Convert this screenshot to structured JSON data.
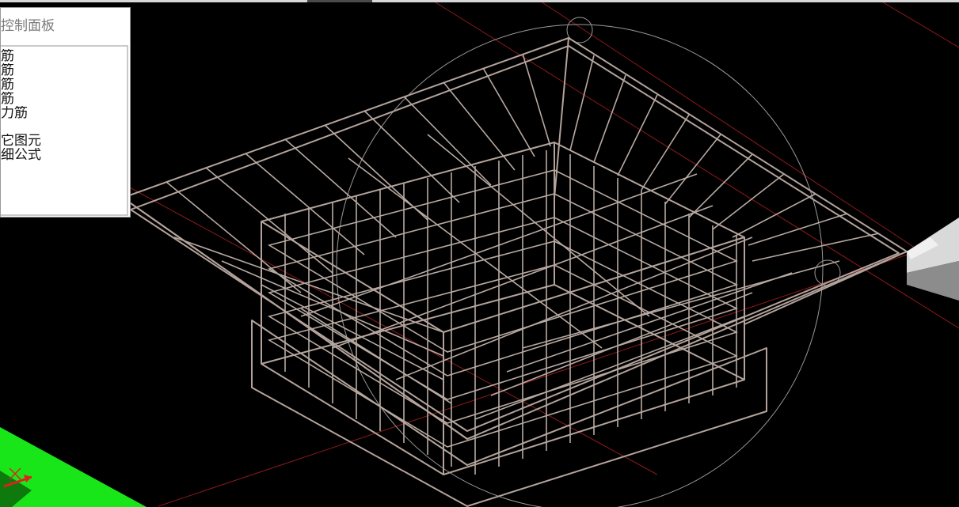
{
  "panel": {
    "title": "控制面板",
    "items": [
      {
        "label": "筋"
      },
      {
        "label": "筋"
      },
      {
        "label": "筋"
      },
      {
        "label": "筋"
      },
      {
        "label": "力筋"
      },
      {
        "label": "它图元"
      },
      {
        "label": "细公式"
      }
    ]
  },
  "colors": {
    "background": "#000000",
    "rebar": "#b3a39b",
    "axis_red": "#8b1a1a",
    "ground": "#19e619",
    "panel_bg": "#ffffff"
  },
  "icons": [
    "view-cube-icon",
    "axis-gizmo-icon",
    "orbit-circle-icon"
  ]
}
